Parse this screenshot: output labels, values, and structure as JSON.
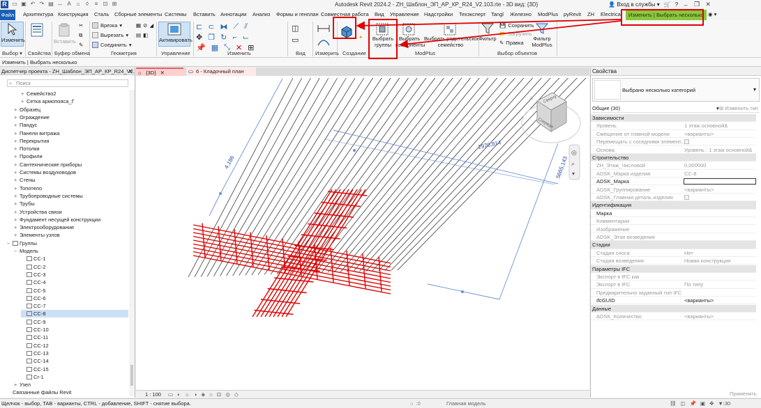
{
  "app": {
    "logo": "R",
    "title": "Autodesk Revit 2024.2 - ZH_Шаблон_ЭП_АР_КР_R24_V2.103.rte - 3D вид: {3D}",
    "login": "Вход в службы",
    "help": "?"
  },
  "menu": {
    "file": "Файл",
    "tabs": [
      "Архитектура",
      "Конструкция",
      "Сталь",
      "Сборные элементы",
      "Системы",
      "Вставить",
      "Аннотации",
      "Анализ",
      "Формы и генплан",
      "Совместная работа",
      "Вид",
      "Управление",
      "Надстройки",
      "Техэксперт",
      "Tangl",
      "Железно",
      "ModPlus",
      "pyRevit",
      "ZH",
      "Electrical"
    ],
    "context_tab": "Изменить | Выбрать несколько"
  },
  "ribbon": {
    "modify": "Изменить",
    "selection_group": "Выбор",
    "properties": "Свойства",
    "paste": "Вставить",
    "clipboard_group": "Буфер обмена",
    "cut_in": "Врезка",
    "cut": "Вырезать",
    "join": "Соединить",
    "geometry_group": "Геометрия",
    "activate": "Активировать",
    "control_group": "Управление",
    "modify_group": "Изменить",
    "view_group": "Вид",
    "measure_group": "Измерить",
    "create_group": "Создание",
    "select_groups_l1": "Выбрать",
    "select_groups_l2": "группы",
    "select_components_l1": "Выбрать",
    "select_components_l2": "компоненты",
    "select_parent_l1": "Выбрать родительское",
    "select_parent_l2": "семейство",
    "modplus_group": "ModPlus",
    "filter": "Фильтр",
    "save": "Сохранить",
    "load": "Загрузить",
    "edit": "Правка",
    "filter_modplus_l1": "Фильтр",
    "filter_modplus_l2": "ModPlus",
    "selection_objects_group": "Выбор объектов"
  },
  "context_bar": "Изменить | Выбрать несколько",
  "project_browser": {
    "title": "Диспетчер проекта - ZH_Шаблон_ЭП_АР_КР_R24_V2.103...",
    "search_placeholder": "Поиск",
    "items": [
      {
        "label": "Семейство2",
        "pm": "+",
        "level": 2
      },
      {
        "label": "Сетка армопояса_Г",
        "pm": "+",
        "level": 2
      },
      {
        "label": "Образец",
        "pm": "+",
        "level": 1
      },
      {
        "label": "Ограждение",
        "pm": "+",
        "level": 1
      },
      {
        "label": "Пандус",
        "pm": "+",
        "level": 1
      },
      {
        "label": "Панели витража",
        "pm": "+",
        "level": 1
      },
      {
        "label": "Перекрытия",
        "pm": "+",
        "level": 1
      },
      {
        "label": "Потолки",
        "pm": "+",
        "level": 1
      },
      {
        "label": "Профили",
        "pm": "+",
        "level": 1
      },
      {
        "label": "Сантехнические приборы",
        "pm": "+",
        "level": 1
      },
      {
        "label": "Системы воздуховодов",
        "pm": "+",
        "level": 1
      },
      {
        "label": "Стены",
        "pm": "+",
        "level": 1
      },
      {
        "label": "Топотело",
        "pm": "+",
        "level": 1
      },
      {
        "label": "Трубопроводные системы",
        "pm": "+",
        "level": 1
      },
      {
        "label": "Трубы",
        "pm": "+",
        "level": 1
      },
      {
        "label": "Устройства связи",
        "pm": "+",
        "level": 1
      },
      {
        "label": "Фундамент несущей конструкции",
        "pm": "+",
        "level": 1
      },
      {
        "label": "Электрооборудование",
        "pm": "+",
        "level": 1
      },
      {
        "label": "Элементы узлов",
        "pm": "+",
        "level": 1
      },
      {
        "label": "Группы",
        "pm": "−",
        "level": 0,
        "icon": true
      },
      {
        "label": "Модель",
        "pm": "−",
        "level": 1
      },
      {
        "label": "СС-1",
        "pm": "",
        "level": 2,
        "icon": true
      },
      {
        "label": "СС-2",
        "pm": "",
        "level": 2,
        "icon": true
      },
      {
        "label": "СС-3",
        "pm": "",
        "level": 2,
        "icon": true
      },
      {
        "label": "СС-4",
        "pm": "",
        "level": 2,
        "icon": true
      },
      {
        "label": "СС-5",
        "pm": "",
        "level": 2,
        "icon": true
      },
      {
        "label": "СС-6",
        "pm": "",
        "level": 2,
        "icon": true
      },
      {
        "label": "СС-7",
        "pm": "",
        "level": 2,
        "icon": true
      },
      {
        "label": "СС-8",
        "pm": "",
        "level": 2,
        "icon": true,
        "selected": true
      },
      {
        "label": "СС-9",
        "pm": "",
        "level": 2,
        "icon": true
      },
      {
        "label": "СС-10",
        "pm": "",
        "level": 2,
        "icon": true
      },
      {
        "label": "СС-11",
        "pm": "",
        "level": 2,
        "icon": true
      },
      {
        "label": "СС-12",
        "pm": "",
        "level": 2,
        "icon": true
      },
      {
        "label": "СС-13",
        "pm": "",
        "level": 2,
        "icon": true
      },
      {
        "label": "СС-14",
        "pm": "",
        "level": 2,
        "icon": true
      },
      {
        "label": "СС-15",
        "pm": "",
        "level": 2,
        "icon": true
      },
      {
        "label": "Сг-1",
        "pm": "",
        "level": 2,
        "icon": true
      },
      {
        "label": "Узел",
        "pm": "+",
        "level": 1
      },
      {
        "label": "Связанные файлы Revit",
        "pm": "",
        "level": 0
      }
    ]
  },
  "view_tabs": [
    {
      "label": "{3D}",
      "active": true
    },
    {
      "label": "6 - Кладочный план",
      "active": false
    }
  ],
  "canvas": {
    "dim_1": "4,186",
    "dim_2": "2970,814",
    "dim_3": "5665,143",
    "viewcube_top": "Сверху",
    "viewcube_front": "Спереди"
  },
  "view_control": {
    "scale": "1 : 100"
  },
  "properties": {
    "title": "Свойства",
    "type_name": "Выбрано несколько категорий",
    "instance_filter": "Общие (30)",
    "edit_type": "Изменить тип",
    "rows": [
      {
        "kind": "head",
        "k": "Зависимости"
      },
      {
        "k": "Уровень",
        "v": "1 этаж основной&"
      },
      {
        "k": "Смещение от главной модели",
        "v": "<варианты>"
      },
      {
        "k": "Перемещать с соседними элемент...",
        "v": "",
        "check": true
      },
      {
        "k": "Основа",
        "v": "Уровень : 1 этаж основной&"
      },
      {
        "kind": "head",
        "k": "Строительство"
      },
      {
        "k": "ZH_Этаж_Числовой",
        "v": "0,000000"
      },
      {
        "k": "ADSK_Марка изделия",
        "v": "СС-8"
      },
      {
        "k": "ADSK_Марка",
        "v": "",
        "edit": true,
        "dark": true
      },
      {
        "k": "ADSK_Группирование",
        "v": "<варианты>"
      },
      {
        "k": "ADSK_Главная деталь изделия",
        "v": "",
        "check": true
      },
      {
        "kind": "head",
        "k": "Идентификация"
      },
      {
        "k": "Марка",
        "v": "",
        "dark": true
      },
      {
        "k": "Комментарии",
        "v": ""
      },
      {
        "k": "Изображение",
        "v": ""
      },
      {
        "k": "ADSK_Этап возведения",
        "v": ""
      },
      {
        "kind": "head",
        "k": "Стадии"
      },
      {
        "k": "Стадия сноса",
        "v": "Нет"
      },
      {
        "k": "Стадия возведения",
        "v": "Новая конструкция"
      },
      {
        "kind": "head",
        "k": "Параметры IFC"
      },
      {
        "k": "Экспорт в IFC как",
        "v": ""
      },
      {
        "k": "Экспорт в IFC",
        "v": "По типу"
      },
      {
        "k": "Предварительно заданный тип IFC",
        "v": ""
      },
      {
        "k": "IfcGUID",
        "v": "<варианты>",
        "dark": true
      },
      {
        "kind": "head",
        "k": "Данные"
      },
      {
        "k": "ADSK_Количество",
        "v": "<варианты>"
      }
    ],
    "apply": "Применить"
  },
  "status": {
    "message": "Щелчок - выбор, TAB - варианты, CTRL - добавление, SHIFT - снятие выбора.",
    "workset_count": ":0",
    "model": "Главная модель",
    "selected_count": ":30"
  },
  "colors": {
    "accent": "#1c5fb5",
    "context_tab": "#8cc63f",
    "annotation": "#e00000",
    "rebar": "#e00000"
  }
}
